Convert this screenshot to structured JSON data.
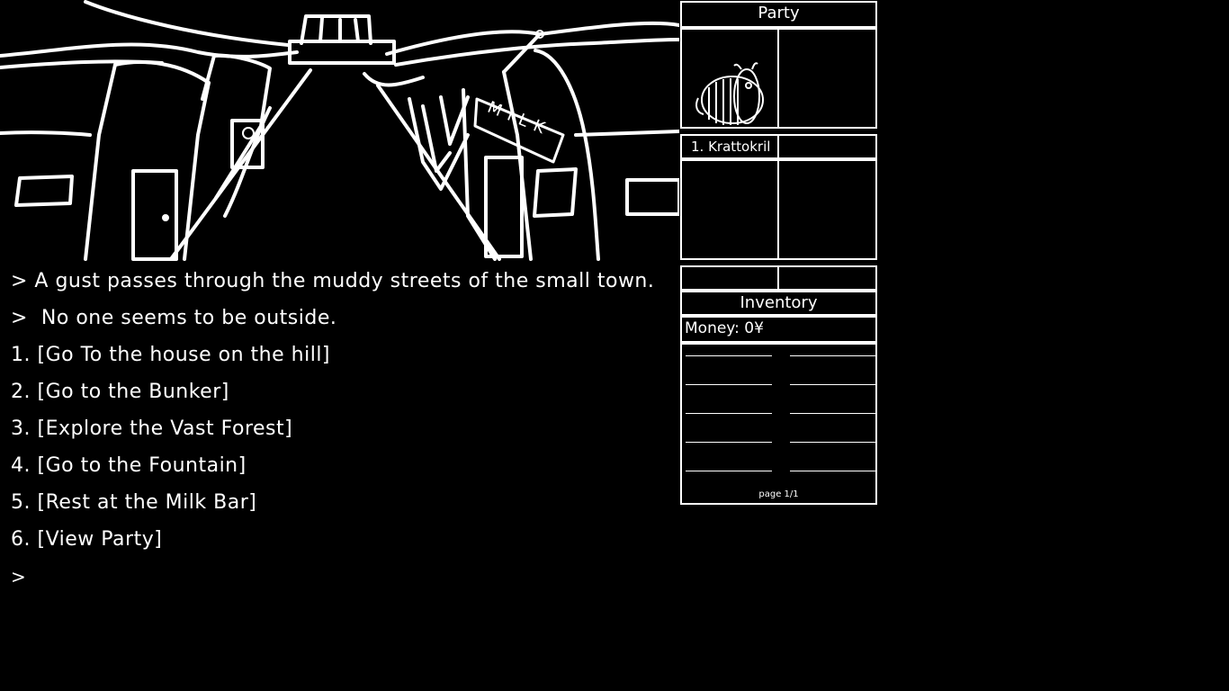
{
  "log": {
    "lines": [
      "> A gust passes through the muddy streets of the small town.",
      ">  No one seems to be outside."
    ],
    "options": [
      "1. [Go To the house on the hill]",
      "2. [Go to the Bunker]",
      "3. [Explore the Vast Forest]",
      "4. [Go to the Fountain]",
      "5. [Rest at the Milk Bar]",
      "6. [View Party]"
    ],
    "prompt": ">"
  },
  "scene": {
    "sign_text": "MILK"
  },
  "party": {
    "title": "Party",
    "members": [
      {
        "name": "1. Krattokril",
        "portrait": "bug-creature-icon"
      }
    ]
  },
  "inventory": {
    "title": "Inventory",
    "money": "Money: 0¥",
    "page": "page 1/1"
  }
}
